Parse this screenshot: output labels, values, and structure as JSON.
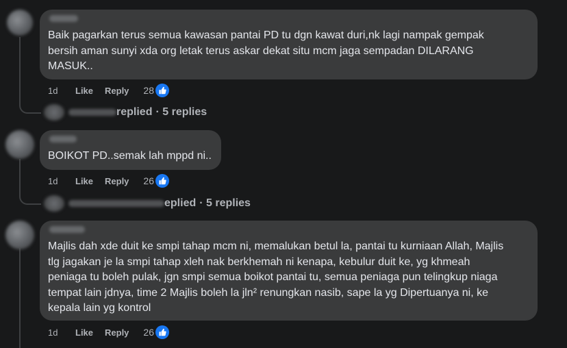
{
  "comments": [
    {
      "text": "Baik pagarkan terus semua kawasan pantai PD tu dgn kawat duri,nk lagi nampak gempak\nbersih aman sunyi xda org letak terus askar dekat situ mcm jaga sempadan DILARANG\nMASUK..",
      "time": "1d",
      "like_label": "Like",
      "reply_label": "Reply",
      "reaction_count": "28",
      "replies_summary": {
        "replied": "replied",
        "count": "· 5 replies"
      }
    },
    {
      "text": "BOIKOT PD..semak lah mppd ni..",
      "time": "1d",
      "like_label": "Like",
      "reply_label": "Reply",
      "reaction_count": "26",
      "replies_summary": {
        "replied": "eplied",
        "count": "· 5 replies"
      }
    },
    {
      "text": "Majlis dah xde duit ke smpi tahap mcm ni, memalukan betul la, pantai tu kurniaan Allah, Majlis\ntlg jagakan je la smpi tahap xleh nak berkhemah ni kenapa, kebulur duit ke, yg khmeah\npeniaga tu boleh pulak, jgn smpi semua boikot pantai tu, semua peniaga pun telingkup niaga\ntempat lain jdnya, time 2 Majlis boleh la jln² renungkan nasib, sape la yg Dipertuanya ni, ke\nkepala lain yg kontrol",
      "time": "1d",
      "like_label": "Like",
      "reply_label": "Reply",
      "reaction_count": "26"
    }
  ],
  "icons": {
    "reaction": "thumbs-up-icon"
  },
  "colors": {
    "background": "#18191a",
    "bubble": "#3a3b3c",
    "like_blue": "#1877f2",
    "meta_text": "#b0b3b8"
  }
}
